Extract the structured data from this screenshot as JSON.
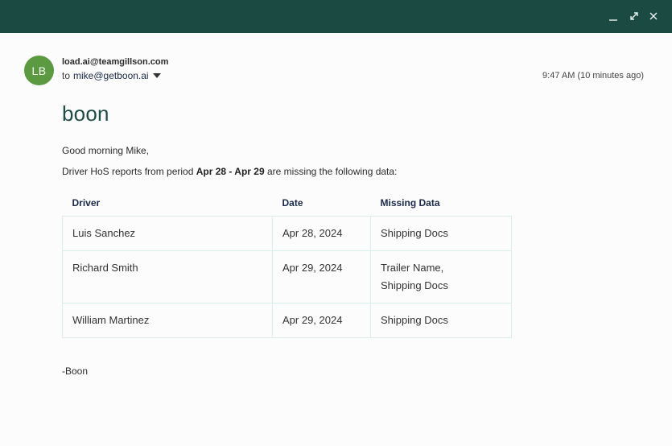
{
  "window": {
    "controls": {
      "minimize_icon": "minimize-icon",
      "maximize_icon": "expand-icon",
      "close_icon": "close-icon"
    },
    "titlebar_color": "#1b4a42"
  },
  "message": {
    "avatar_initials": "LB",
    "avatar_color": "#5b9a41",
    "from": "load.ai@teamgillson.com",
    "to_prefix": "to",
    "to": "mike@getboon.ai",
    "timestamp": "9:47 AM (10 minutes ago)"
  },
  "body": {
    "brand": "boon",
    "greeting": "Good morning Mike,",
    "intro_prefix": "Driver HoS reports from period ",
    "intro_period": "Apr 28 - Apr 29",
    "intro_suffix": " are missing the following data:",
    "table": {
      "headers": [
        "Driver",
        "Date",
        "Missing Data"
      ],
      "rows": [
        {
          "driver": "Luis Sanchez",
          "date": "Apr 28, 2024",
          "missing": [
            "Shipping Docs"
          ]
        },
        {
          "driver": "Richard Smith",
          "date": "Apr 29, 2024",
          "missing": [
            "Trailer Name,",
            "Shipping Docs"
          ]
        },
        {
          "driver": "William Martinez",
          "date": "Apr 29, 2024",
          "missing": [
            "Shipping Docs"
          ]
        }
      ]
    },
    "signature": "-Boon"
  }
}
